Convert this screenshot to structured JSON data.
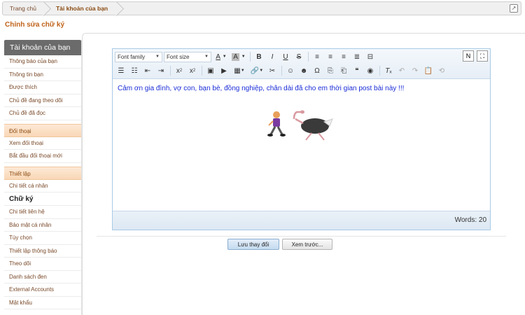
{
  "breadcrumb": {
    "home": "Trang chủ",
    "current": "Tài khoản của bạn"
  },
  "page": {
    "title": "Chỉnh sửa chữ ký"
  },
  "sidebar": {
    "header": "Tài khoản của bạn",
    "group1": [
      "Thông báo của bạn",
      "Thông tin bạn",
      "Được thích",
      "Chủ đề đang theo dõi",
      "Chủ đề đã đọc"
    ],
    "section2": "Đối thoại",
    "group2": [
      "Xem đối thoại",
      "Bắt đầu đối thoại mới"
    ],
    "section3": "Thiết lập",
    "group3a": [
      "Chi tiết cá nhân"
    ],
    "active": "Chữ ký",
    "group3b": [
      "Chi tiết liên hệ",
      "Bảo mật cá nhân",
      "Tùy chọn",
      "Thiết lập thông báo",
      "Theo dõi",
      "Danh sách đen",
      "External Accounts",
      "Mật khẩu"
    ]
  },
  "editor": {
    "font_family": "Font family",
    "font_size": "Font size",
    "content": "Cảm ơn gia đình, vợ con, bạn bè, đồng nghiệp, chân dài đã cho em thời gian post bài này !!!",
    "word_count": "Words: 20"
  },
  "buttons": {
    "save": "Lưu thay đổi",
    "preview": "Xem trước..."
  }
}
